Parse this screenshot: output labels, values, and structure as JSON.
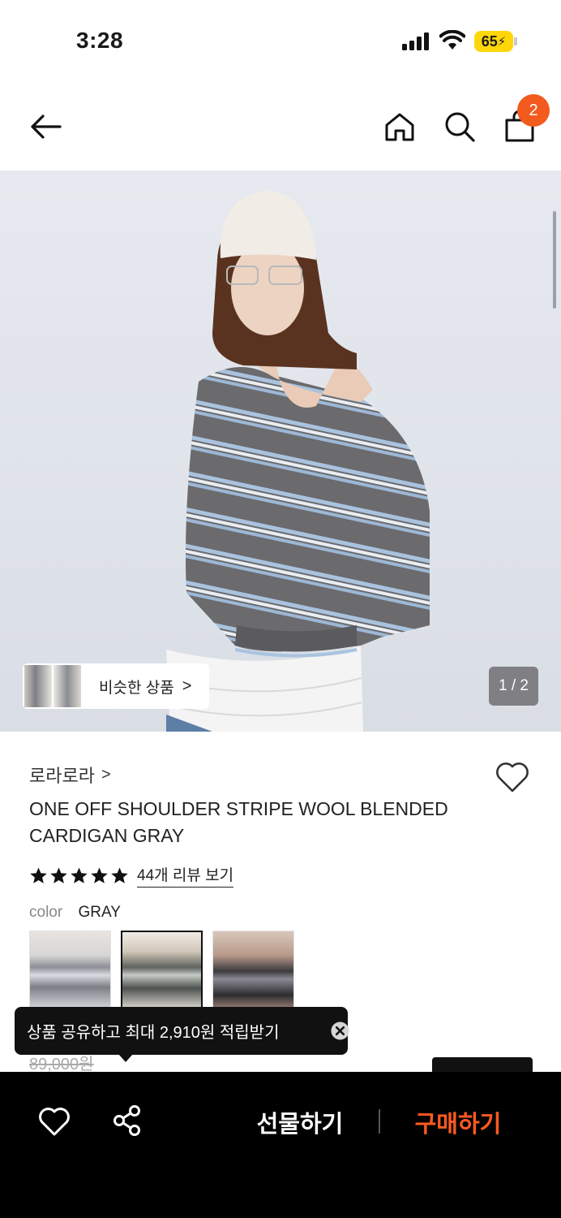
{
  "status_bar": {
    "time": "3:28",
    "battery": "65"
  },
  "header": {
    "icons": [
      "arrow-left-icon",
      "home-icon",
      "search-icon",
      "shopping-bag-icon"
    ],
    "cart_count": "2"
  },
  "gallery": {
    "similar_label": "비슷한 상품",
    "similar_arrow": ">",
    "counter": "1 / 2"
  },
  "product": {
    "brand": "로라로라",
    "brand_arrow": ">",
    "title": "ONE OFF SHOULDER STRIPE WOOL BLENDED CARDIGAN GRAY",
    "rating_stars": 5,
    "review_link": "44개 리뷰 보기",
    "color_label": "color",
    "color_value": "GRAY",
    "swatch_count": 3,
    "selected_swatch": 2,
    "original_price": "89,000원"
  },
  "tooltip": {
    "text": "상품 공유하고 최대 2,910원 적립받기"
  },
  "bottom_bar": {
    "gift_label": "선물하기",
    "buy_label": "구매하기"
  },
  "colors": {
    "accent": "#f25a1e",
    "buy": "#ff5a1f",
    "bar_bg": "#000000",
    "battery": "#ffd60a"
  }
}
